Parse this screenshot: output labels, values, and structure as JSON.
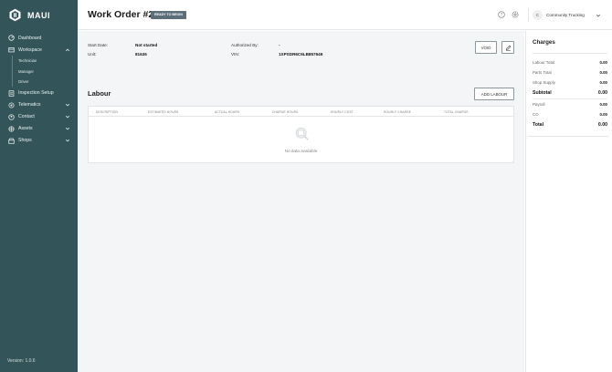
{
  "app": {
    "name": "MAUI",
    "version": "Version: 1.0.6"
  },
  "sidebar": {
    "items": [
      {
        "label": "Dashboard",
        "icon": "dashboard-icon"
      },
      {
        "label": "Workspace",
        "icon": "workspace-icon",
        "expanded": true,
        "children": [
          "Technician",
          "Manager",
          "Driver"
        ]
      },
      {
        "label": "Inspection Setup",
        "icon": "inspection-icon"
      },
      {
        "label": "Telematics",
        "icon": "telematics-icon",
        "expandable": true
      },
      {
        "label": "Contact",
        "icon": "contact-icon",
        "expandable": true
      },
      {
        "label": "Assets",
        "icon": "assets-icon",
        "expandable": true
      },
      {
        "label": "Shops",
        "icon": "shops-icon",
        "expandable": true
      }
    ]
  },
  "header": {
    "title": "Work Order #2",
    "status": "READY TO BEGIN",
    "account": {
      "initial": "C",
      "name": "Community Trucking"
    }
  },
  "details": {
    "start_date_label": "Start Date:",
    "start_date": "Not started",
    "unit_label": "Unit:",
    "unit": "81636",
    "authorized_by_label": "Authorized By:",
    "authorized_by": "-",
    "vin_label": "VIN:",
    "vin": "1XPSDR6C6LB857649"
  },
  "actions": {
    "void_label": "VOID",
    "add_labour_label": "ADD LABOUR"
  },
  "labour": {
    "title": "Labour",
    "columns": [
      "DESCRIPTION",
      "ESTIMATED HOURS",
      "ACTUAL HOURS",
      "CHARGE HOURS",
      "HOURLY COST",
      "HOURLY CHARGE",
      "TOTAL CHARGE"
    ],
    "empty_text": "No data available"
  },
  "charges": {
    "title": "Charges",
    "rows": [
      {
        "label": "Labour Total",
        "value": "0.00"
      },
      {
        "label": "Parts Total",
        "value": "0.00"
      },
      {
        "label": "Shop Supply",
        "value": "0.00"
      },
      {
        "label": "Subtotal",
        "value": "0.00"
      },
      {
        "label": "Payroll",
        "value": "0.00"
      },
      {
        "label": "CO",
        "value": "0.00"
      },
      {
        "label": "Total",
        "value": "0.00"
      }
    ]
  },
  "colors": {
    "sidebar": "#335559",
    "badge": "#5b6e7a",
    "background": "#f4f5f6"
  }
}
